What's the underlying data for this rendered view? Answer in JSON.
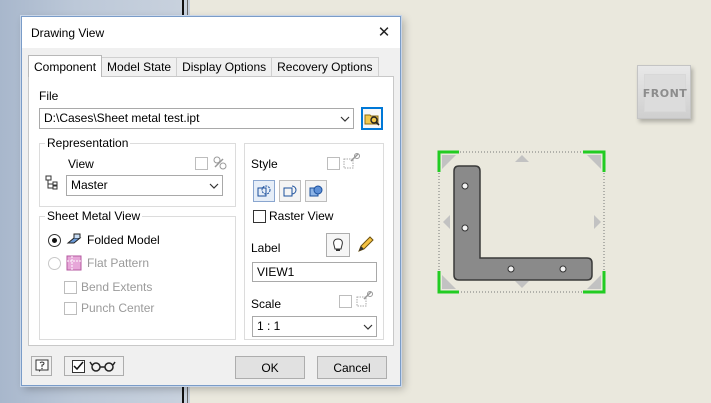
{
  "viewcube": {
    "face_label": "FRONT"
  },
  "dialog": {
    "title": "Drawing View",
    "close_glyph": "✕",
    "tabs": [
      {
        "label": "Component"
      },
      {
        "label": "Model State"
      },
      {
        "label": "Display Options"
      },
      {
        "label": "Recovery Options"
      }
    ],
    "file": {
      "label": "File",
      "value": "D:\\Cases\\Sheet metal test.ipt",
      "browse_icon": "folder-browse-icon"
    },
    "representation": {
      "group_label": "Representation",
      "view_label": "View",
      "view_value": "Master"
    },
    "sheet_metal_view": {
      "group_label": "Sheet Metal View",
      "folded_model": "Folded Model",
      "flat_pattern": "Flat Pattern",
      "bend_extents": "Bend Extents",
      "punch_center": "Punch Center",
      "selected": "Folded Model"
    },
    "style": {
      "label": "Style",
      "raster_view": "Raster View"
    },
    "label_section": {
      "label": "Label",
      "value": "VIEW1"
    },
    "scale": {
      "label": "Scale",
      "value": "1 : 1"
    },
    "buttons": {
      "ok": "OK",
      "cancel": "Cancel"
    }
  },
  "colors": {
    "accent": "#0078d7",
    "selection_green": "#22cc22",
    "part_gray": "#8a8a8a"
  }
}
